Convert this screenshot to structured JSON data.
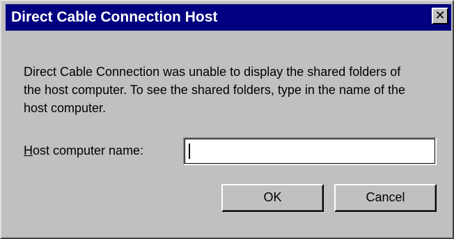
{
  "window": {
    "title": "Direct Cable Connection Host",
    "close_label": "✕",
    "close_icon": "close-icon",
    "colors": {
      "titlebar": "#000080",
      "face": "#c0c0c0"
    }
  },
  "message": "Direct Cable Connection was unable to display the shared folders of the host computer. To see the shared folders, type in the name of the host computer.",
  "form": {
    "host_label_accel": "H",
    "host_label_rest": "ost computer name:",
    "host_value": ""
  },
  "buttons": {
    "ok_label": "OK",
    "cancel_label": "Cancel"
  }
}
